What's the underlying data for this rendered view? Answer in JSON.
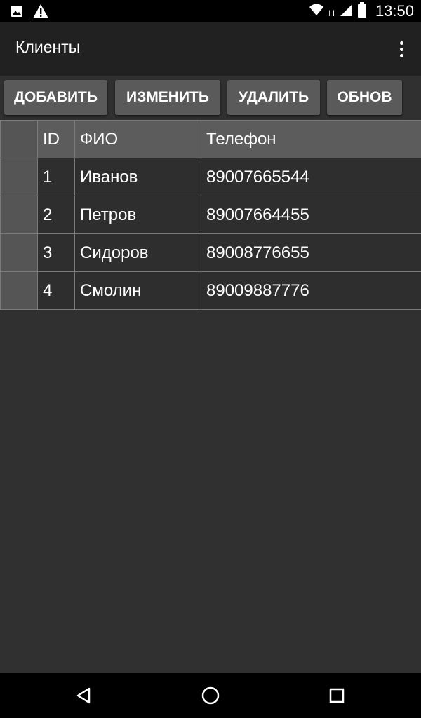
{
  "status_bar": {
    "time": "13:50",
    "network_label": "H",
    "left_icons": [
      "image-icon",
      "warning-icon"
    ],
    "right_icons": [
      "wifi-icon",
      "signal-icon",
      "battery-icon"
    ]
  },
  "app_bar": {
    "title": "Клиенты",
    "menu_icon": "overflow-menu-icon"
  },
  "toolbar": {
    "add_label": "ДОБАВИТЬ",
    "edit_label": "ИЗМЕНИТЬ",
    "delete_label": "УДАЛИТЬ",
    "refresh_label": "ОБНОВ"
  },
  "table": {
    "columns": [
      "",
      "ID",
      "ФИО",
      "Телефон"
    ],
    "rows": [
      {
        "id": "1",
        "fio": "Иванов",
        "phone": "89007665544"
      },
      {
        "id": "2",
        "fio": "Петров",
        "phone": "89007664455"
      },
      {
        "id": "3",
        "fio": "Сидоров",
        "phone": "89008776655"
      },
      {
        "id": "4",
        "fio": "Смолин",
        "phone": "89009887776"
      }
    ]
  },
  "nav_bar": {
    "icons": [
      "back-icon",
      "home-icon",
      "recent-apps-icon"
    ]
  },
  "colors": {
    "background": "#303030",
    "app_bar": "#212121",
    "button": "#5a5a5a",
    "header_row": "#5c5c5c",
    "grid_line": "#7a7a7a"
  }
}
